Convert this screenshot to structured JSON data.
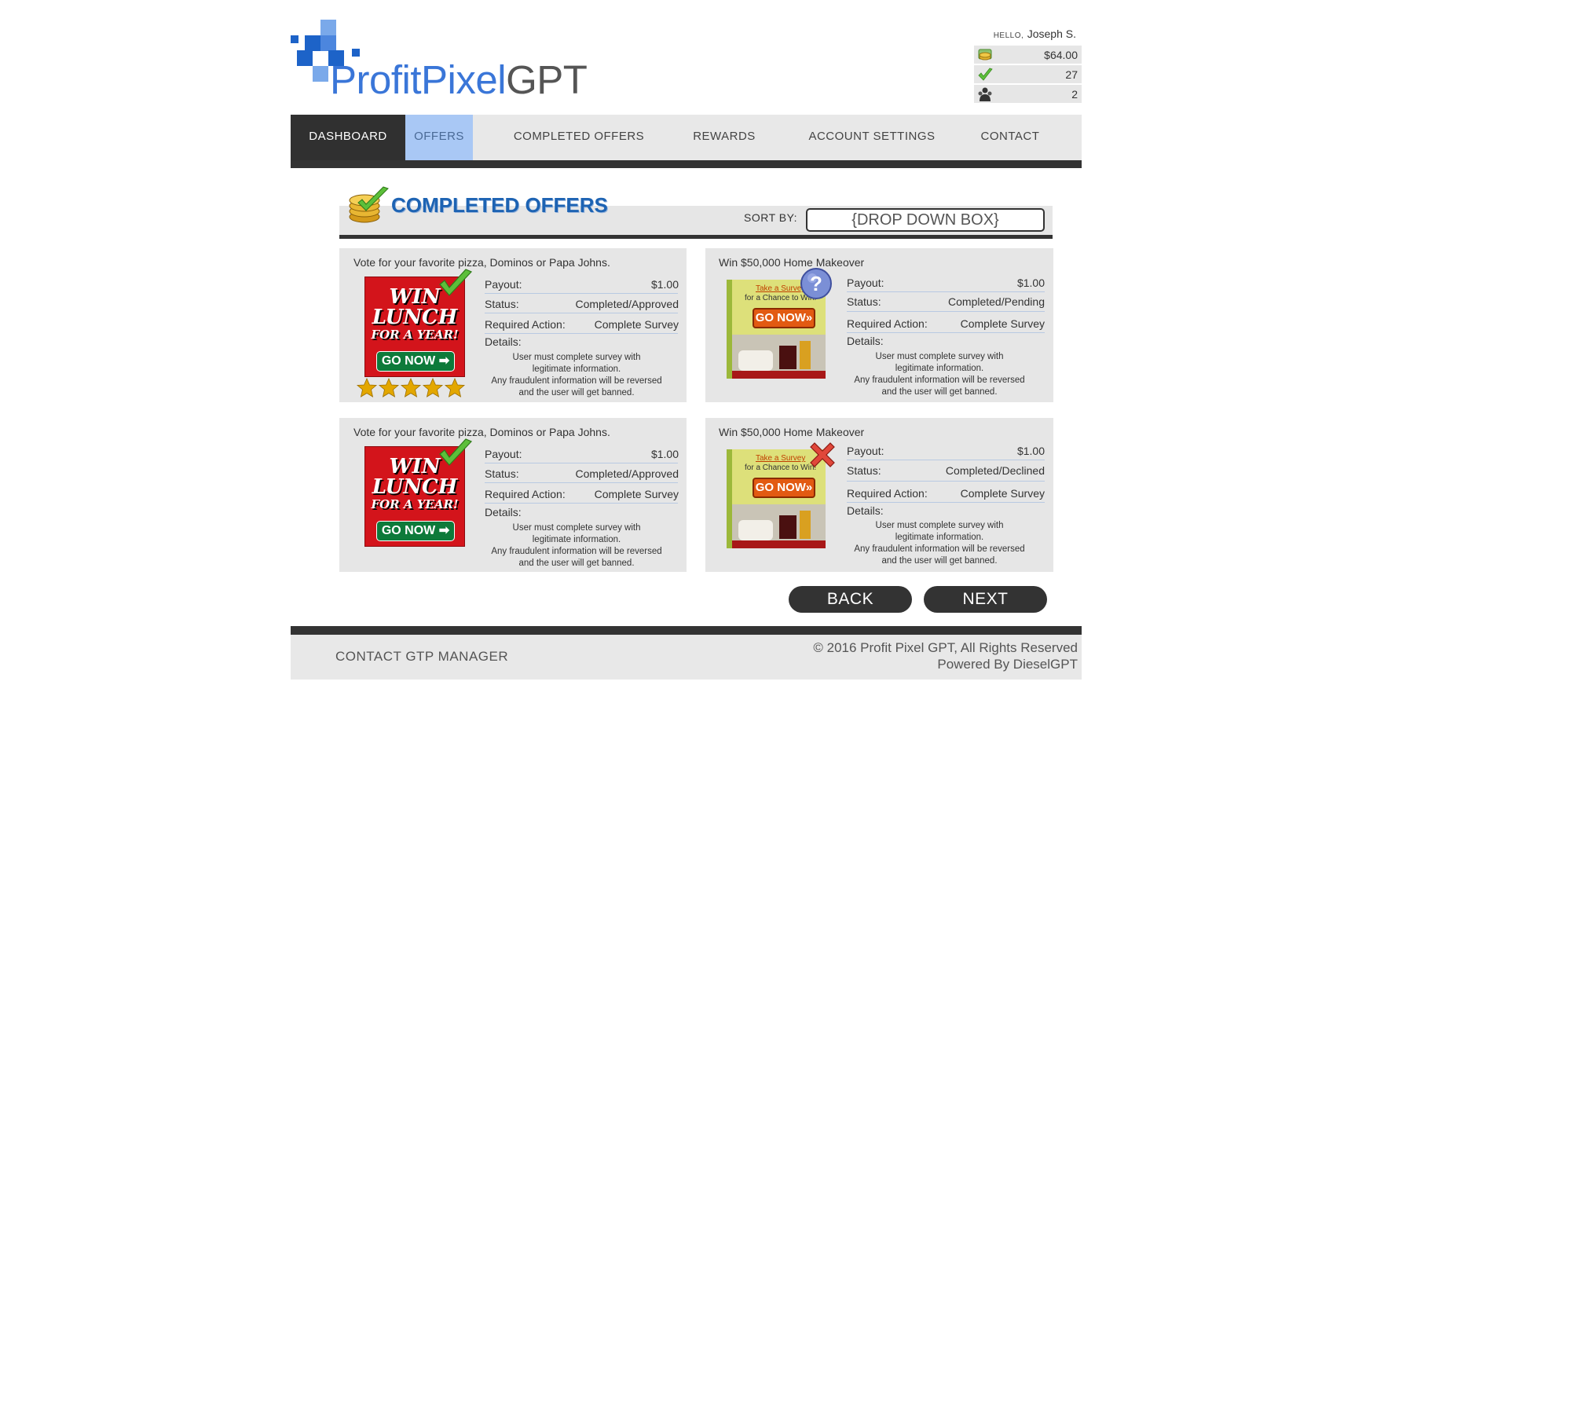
{
  "logo": {
    "part1": "ProfitPixel",
    "part2": "GPT"
  },
  "user": {
    "hello_label": "HELLO,",
    "name": "Joseph S.",
    "balance": "$64.00",
    "completed_count": "27",
    "referrals": "2"
  },
  "nav": {
    "items": [
      "DASHBOARD",
      "OFFERS",
      "COMPLETED OFFERS",
      "REWARDS",
      "ACCOUNT SETTINGS",
      "CONTACT"
    ],
    "active": "OFFERS"
  },
  "section": {
    "title": "COMPLETED OFFERS",
    "sort_label": "SORT BY:",
    "dropdown": "{DROP DOWN BOX}"
  },
  "labels": {
    "payout": "Payout:",
    "status": "Status:",
    "required_action": "Required Action:",
    "details": "Details:"
  },
  "offers": [
    {
      "title": "Vote for your favorite pizza, Dominos or Papa Johns.",
      "payout": "$1.00",
      "status": "Completed/Approved",
      "action": "Complete Survey",
      "details_1": "User must complete survey with legitimate information.",
      "details_2": "Any fraudulent information will be reversed and the user will get banned.",
      "ad": {
        "l1": "WIN",
        "l2": "LUNCH",
        "l3": "FOR A YEAR!",
        "go": "GO NOW ➡"
      },
      "badge": "check-icon",
      "rating": 5
    },
    {
      "title": "Win $50,000 Home Makeover",
      "payout": "$1.00",
      "status": "Completed/Pending",
      "action": "Complete Survey",
      "details_1": "User must complete survey with legitimate information.",
      "details_2": "Any fraudulent information will be reversed and the user will get banned.",
      "ad": {
        "l1": "Take a Survey",
        "l2": "for a Chance to Win!",
        "go": "GO NOW»"
      },
      "badge": "question-icon"
    },
    {
      "title": "Vote for your favorite pizza, Dominos or Papa Johns.",
      "payout": "$1.00",
      "status": "Completed/Approved",
      "action": "Complete Survey",
      "details_1": "User must complete survey with legitimate information.",
      "details_2": "Any fraudulent information will be reversed and the user will get banned.",
      "ad": {
        "l1": "WIN",
        "l2": "LUNCH",
        "l3": "FOR A YEAR!",
        "go": "GO NOW ➡"
      },
      "badge": "check-icon"
    },
    {
      "title": "Win $50,000 Home Makeover",
      "payout": "$1.00",
      "status": "Completed/Declined",
      "action": "Complete Survey",
      "details_1": "User must complete survey with legitimate information.",
      "details_2": "Any fraudulent information will be reversed and the user will get banned.",
      "ad": {
        "l1": "Take a Survey",
        "l2": "for a Chance to Win!",
        "go": "GO NOW»"
      },
      "badge": "x-icon"
    }
  ],
  "pagination": {
    "back": "BACK",
    "next": "NEXT"
  },
  "footer": {
    "contact": "CONTACT GTP MANAGER",
    "copyright": "© 2016 Profit Pixel GPT, All Rights Reserved",
    "powered": "Powered By DieselGPT"
  },
  "colors": {
    "brand_blue": "#3a76d8",
    "title_blue": "#1d63b3",
    "nav_active_bg": "#a9c8f5",
    "nav_dark": "#303030",
    "card_bg": "#e6e6e6"
  }
}
